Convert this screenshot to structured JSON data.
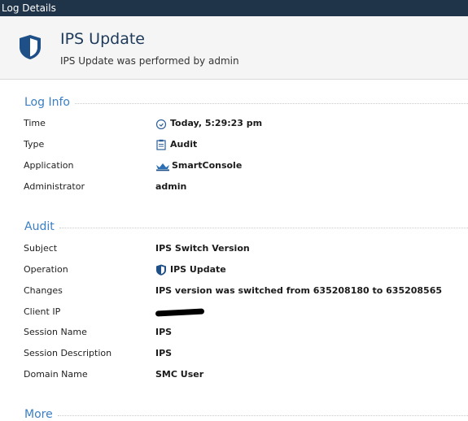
{
  "window": {
    "title": "Log Details"
  },
  "header": {
    "title": "IPS Update",
    "subtitle": "IPS Update was performed by admin",
    "icon": "shield-icon"
  },
  "log_info": {
    "title": "Log Info",
    "rows": [
      {
        "label": "Time",
        "value": "Today, 5:29:23 pm",
        "icon": "clock-icon"
      },
      {
        "label": "Type",
        "value": "Audit",
        "icon": "audit-icon"
      },
      {
        "label": "Application",
        "value": "SmartConsole",
        "icon": "crown-icon"
      },
      {
        "label": "Administrator",
        "value": "admin"
      }
    ]
  },
  "audit": {
    "title": "Audit",
    "rows": [
      {
        "label": "Subject",
        "value": "IPS Switch Version"
      },
      {
        "label": "Operation",
        "value": "IPS Update",
        "icon": "shield-icon"
      },
      {
        "label": "Changes",
        "value": "IPS version was switched from 635208180 to 635208565"
      },
      {
        "label": "Client IP",
        "value": "",
        "redacted": true
      },
      {
        "label": "Session Name",
        "value": "IPS"
      },
      {
        "label": "Session Description",
        "value": "IPS"
      },
      {
        "label": "Domain Name",
        "value": "SMC User"
      }
    ]
  },
  "more": {
    "title": "More"
  },
  "colors": {
    "titlebar": "#1f3349",
    "section_title": "#3a7fc4",
    "shield": "#1e4f86"
  }
}
